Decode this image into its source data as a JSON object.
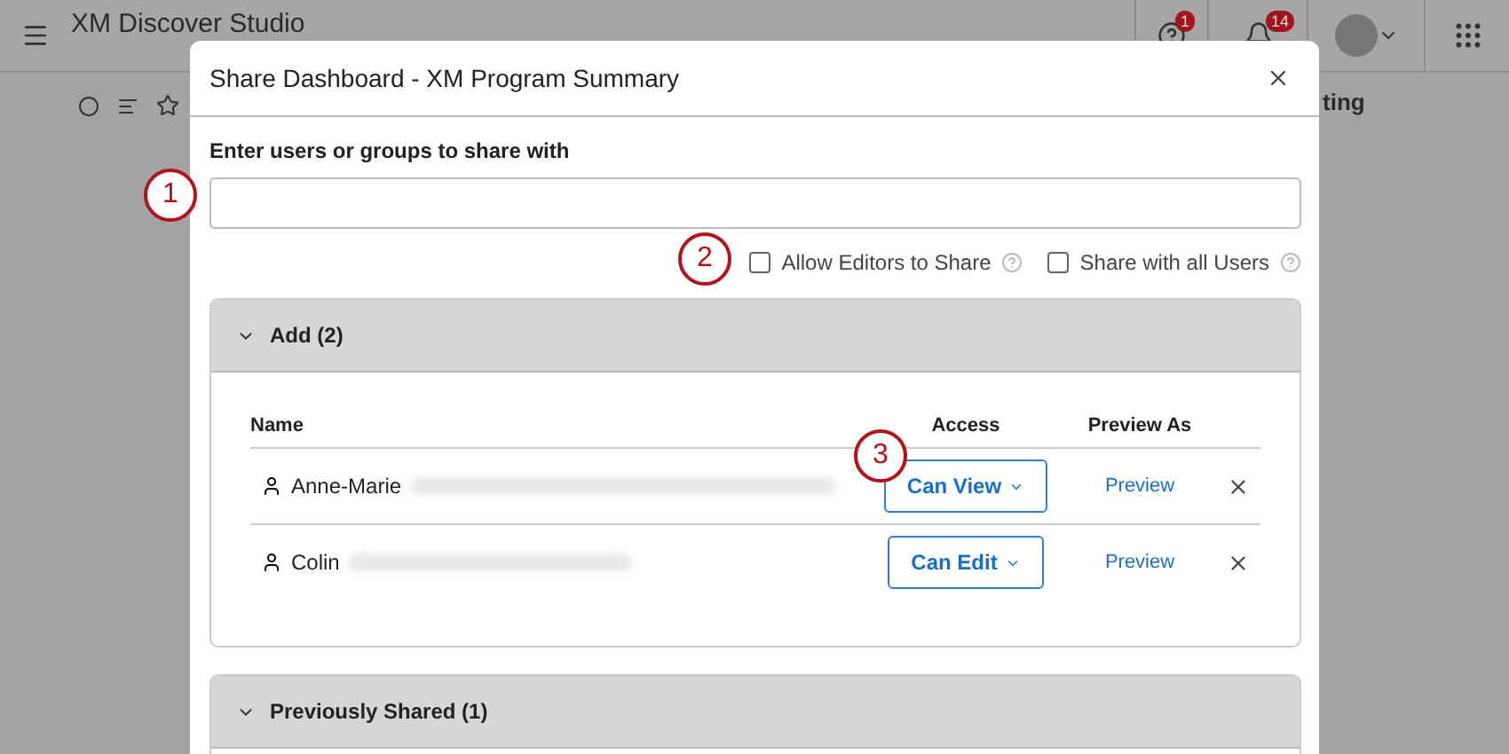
{
  "app": {
    "title": "XM Discover Studio",
    "badges": [
      "1",
      "14"
    ],
    "column_header": "ting"
  },
  "dialog": {
    "title": "Share Dashboard - XM Program Summary",
    "share_label": "Enter users or groups to share with",
    "options": [
      {
        "label": "Allow Editors to Share",
        "checked": false
      },
      {
        "label": "Share with all Users",
        "checked": false
      }
    ],
    "sections": [
      {
        "title": "Add (2)",
        "columns": [
          "Name",
          "Access",
          "Preview As"
        ],
        "rows": [
          {
            "name": "Anne-Marie",
            "access": "Can View",
            "preview": "Preview"
          },
          {
            "name": "Colin",
            "access": "Can Edit",
            "preview": "Preview"
          }
        ]
      },
      {
        "title": "Previously Shared (1)"
      }
    ]
  },
  "callouts": [
    "1",
    "2",
    "3"
  ]
}
